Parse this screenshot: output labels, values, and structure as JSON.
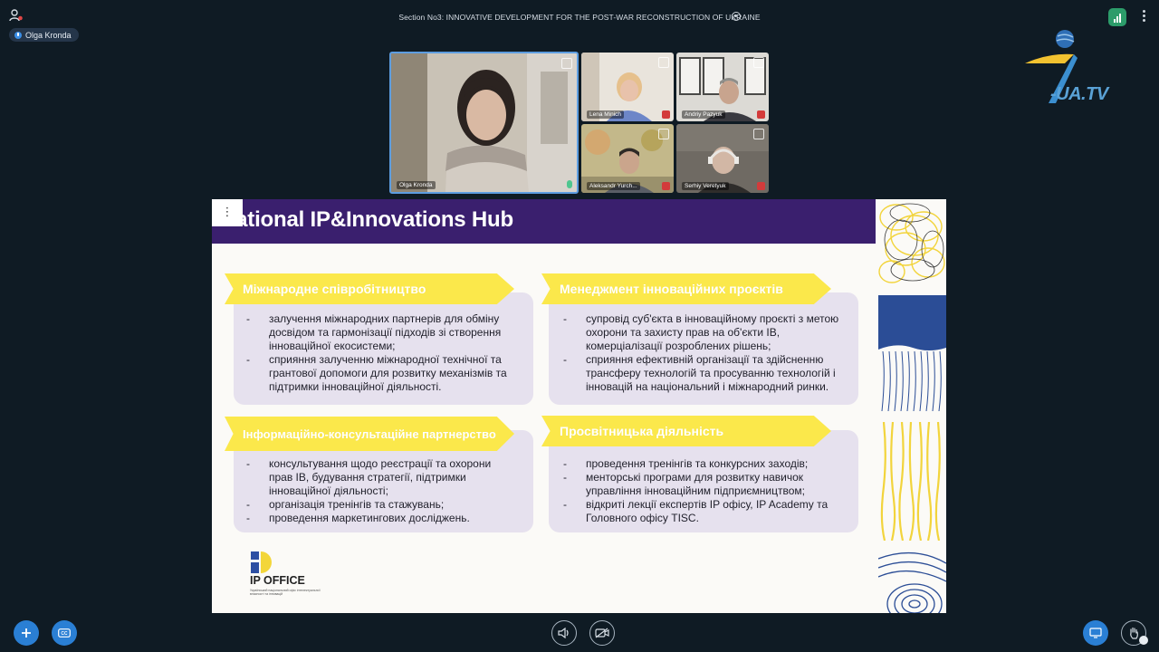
{
  "topbar": {
    "session_title": "Section No3: INNOVATIVE DEVELOPMENT FOR THE POST-WAR RECONSTRUCTION OF UKRAINE",
    "active_speaker": "Olga Kronda"
  },
  "logo": {
    "text": "-UA.TV"
  },
  "participants": {
    "main": {
      "name": "Olga Kronda",
      "mic": "on"
    },
    "tiles": [
      {
        "name": "Lena Minich",
        "mic": "muted"
      },
      {
        "name": "Andriy Pazyuk",
        "mic": "muted"
      },
      {
        "name": "Aleksandr Yurch...",
        "mic": "muted"
      },
      {
        "name": "Serhiy Veretyuk",
        "mic": "muted"
      }
    ]
  },
  "slide": {
    "menu_label": "⋮",
    "title": "National IP&Innovations Hub",
    "sections": [
      {
        "heading": "Міжнародне співробітництво",
        "items": [
          "залучення міжнародних партнерів для обміну досвідом та гармонізації підходів зі створення інноваційної екосистеми;",
          "сприяння залученню міжнародної технічної та грантової допомоги для розвитку механізмів та підтримки інноваційної діяльності."
        ]
      },
      {
        "heading": "Менеджмент інноваційних проєктів",
        "items": [
          "супровід суб'єкта в інноваційному проєкті з метою охорони та захисту прав на об'єкти ІВ, комерціалізації розроблених рішень;",
          "сприяння ефективній організації та здійсненню трансферу технологій та просуванню технологій і інновацій на національний і міжнародний ринки."
        ]
      },
      {
        "heading": "Інформаційно-консультаційне партнерство",
        "items": [
          "консультування щодо реєстрації та охорони прав ІВ, будування стратегії,  підтримки інноваційної діяльності;",
          "організація тренінгів та стажувань;",
          "проведення маркетингових досліджень."
        ]
      },
      {
        "heading": "Просвітницька діяльність",
        "items": [
          "проведення тренінгів та конкурсних заходів;",
          "менторські програми для розвитку навичок управління інноваційним підприємництвом;",
          "відкриті лекції експертів IP офісу, IP Academy та Головного офісу TISC."
        ]
      }
    ],
    "footer_logo": {
      "name": "IP OFFICE",
      "fine_print": "Український національний офіс інтелектуальної власності та інновацій"
    }
  },
  "colors": {
    "background": "#0f1b24",
    "slide_header": "#3a1f6e",
    "banner_yellow": "#fbe84b",
    "panel": "#e6e1ee",
    "accent_blue": "#2a7fd4"
  }
}
